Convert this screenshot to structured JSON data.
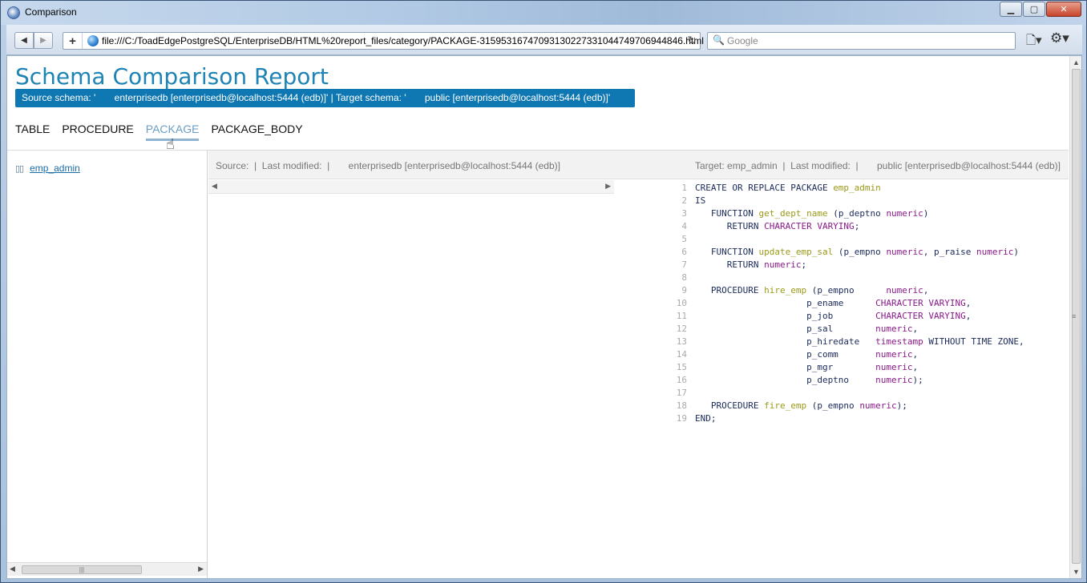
{
  "window": {
    "title": "Comparison",
    "minimize_label": "▁",
    "maximize_label": "▢",
    "close_label": "✕"
  },
  "nav": {
    "back_label": "◀",
    "forward_label": "▶",
    "new_tab_label": "+",
    "url": "file:///C:/ToadEdgePostgreSQL/EnterpriseDB/HTML%20report_files/category/PACKAGE-3159531674709313022733104474970694484​6.html",
    "reload_label": "↻",
    "search_placeholder": "Google",
    "search_icon": "🔍",
    "page_menu_icon": "🗋▾",
    "tools_menu_icon": "⚙▾"
  },
  "page": {
    "title": "Schema Comparison Report",
    "schema_banner": "Source schema: '       enterprisedb [enterprisedb@localhost:5444 (edb)]' | Target schema: '       public [enterprisedb@localhost:5444 (edb)]'",
    "tabs": [
      {
        "label": "TABLE"
      },
      {
        "label": "PROCEDURE"
      },
      {
        "label": "PACKAGE"
      },
      {
        "label": "PACKAGE_BODY"
      }
    ],
    "active_tab": "PACKAGE"
  },
  "tree": {
    "items": [
      {
        "icon": "package-icon",
        "label": "emp_admin"
      }
    ]
  },
  "compare": {
    "source_header": "Source:  |  Last modified:  |       enterprisedb [enterprisedb@localhost:5444 (edb)]",
    "target_header": "Target: emp_admin  |  Last modified:  |       public [enterprisedb@localhost:5444 (edb)]"
  },
  "colors": {
    "keyword": "#1b2a5a",
    "identifier": "#9a9a1a",
    "type": "#8a1a8a",
    "accent": "#1d84b5",
    "banner": "#0f78b3"
  },
  "code": {
    "lines": [
      [
        [
          "kw",
          "CREATE OR REPLACE PACKAGE "
        ],
        [
          "id",
          "emp_admin"
        ]
      ],
      [
        [
          "kw",
          "IS"
        ]
      ],
      [
        [
          "kw",
          "   FUNCTION "
        ],
        [
          "id",
          "get_dept_name"
        ],
        [
          "kw",
          " (p_deptno "
        ],
        [
          "ty",
          "numeric"
        ],
        [
          "kw",
          ")"
        ]
      ],
      [
        [
          "kw",
          "      RETURN "
        ],
        [
          "ty",
          "CHARACTER VARYING"
        ],
        [
          "kw",
          ";"
        ]
      ],
      [],
      [
        [
          "kw",
          "   FUNCTION "
        ],
        [
          "id",
          "update_emp_sal"
        ],
        [
          "kw",
          " (p_empno "
        ],
        [
          "ty",
          "numeric"
        ],
        [
          "kw",
          ", p_raise "
        ],
        [
          "ty",
          "numeric"
        ],
        [
          "kw",
          ")"
        ]
      ],
      [
        [
          "kw",
          "      RETURN "
        ],
        [
          "ty",
          "numeric"
        ],
        [
          "kw",
          ";"
        ]
      ],
      [],
      [
        [
          "kw",
          "   PROCEDURE "
        ],
        [
          "id",
          "hire_emp"
        ],
        [
          "kw",
          " (p_empno      "
        ],
        [
          "ty",
          "numeric"
        ],
        [
          "kw",
          ","
        ]
      ],
      [
        [
          "kw",
          "                     p_ename      "
        ],
        [
          "ty",
          "CHARACTER VARYING"
        ],
        [
          "kw",
          ","
        ]
      ],
      [
        [
          "kw",
          "                     p_job        "
        ],
        [
          "ty",
          "CHARACTER VARYING"
        ],
        [
          "kw",
          ","
        ]
      ],
      [
        [
          "kw",
          "                     p_sal        "
        ],
        [
          "ty",
          "numeric"
        ],
        [
          "kw",
          ","
        ]
      ],
      [
        [
          "kw",
          "                     p_hiredate   "
        ],
        [
          "ty",
          "timestamp"
        ],
        [
          "kw",
          " WITHOUT TIME ZONE,"
        ]
      ],
      [
        [
          "kw",
          "                     p_comm       "
        ],
        [
          "ty",
          "numeric"
        ],
        [
          "kw",
          ","
        ]
      ],
      [
        [
          "kw",
          "                     p_mgr        "
        ],
        [
          "ty",
          "numeric"
        ],
        [
          "kw",
          ","
        ]
      ],
      [
        [
          "kw",
          "                     p_deptno     "
        ],
        [
          "ty",
          "numeric"
        ],
        [
          "kw",
          ");"
        ]
      ],
      [],
      [
        [
          "kw",
          "   PROCEDURE "
        ],
        [
          "id",
          "fire_emp"
        ],
        [
          "kw",
          " (p_empno "
        ],
        [
          "ty",
          "numeric"
        ],
        [
          "kw",
          ");"
        ]
      ],
      [
        [
          "kw",
          "END;"
        ]
      ]
    ]
  }
}
